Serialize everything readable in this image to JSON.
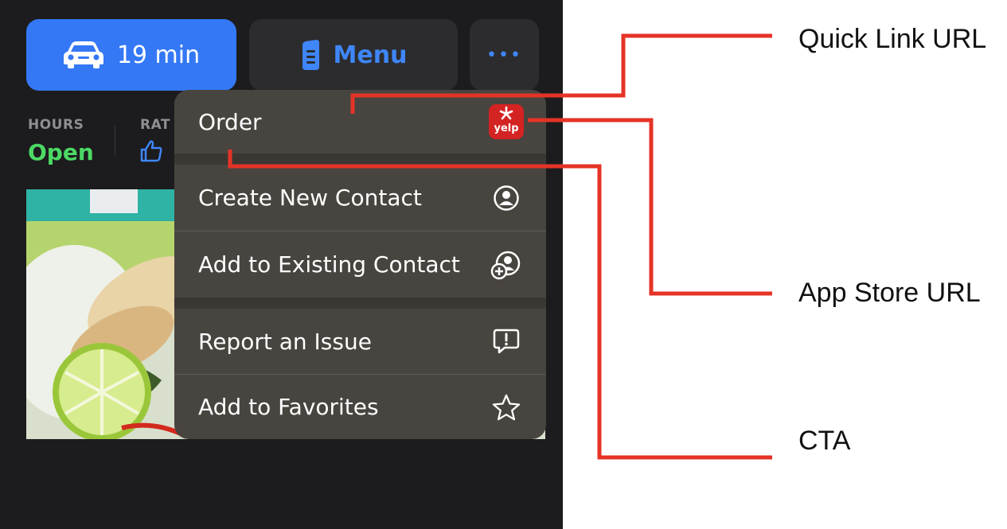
{
  "toolbar": {
    "drive_label": "19 min",
    "menu_label": "Menu",
    "more_label": "•••"
  },
  "info": {
    "hours_label": "HOURS",
    "hours_value": "Open",
    "rating_label_partial": "RAT"
  },
  "context_menu": {
    "items": [
      {
        "label": "Order",
        "icon": "yelp-app-icon",
        "icon_text": "yelp"
      },
      {
        "label": "Create New Contact",
        "icon": "person-circle-icon"
      },
      {
        "label": "Add to Existing Contact",
        "icon": "person-add-icon"
      },
      {
        "label": "Report an Issue",
        "icon": "exclamation-bubble-icon"
      },
      {
        "label": "Add to Favorites",
        "icon": "star-icon"
      }
    ]
  },
  "annotations": {
    "quick_link": "Quick Link URL",
    "app_store": "App Store URL",
    "cta": "CTA"
  },
  "colors": {
    "accent_blue": "#3478f6",
    "open_green": "#4cd964",
    "annotation_red": "#e53326",
    "yelp_red": "#d32323"
  }
}
